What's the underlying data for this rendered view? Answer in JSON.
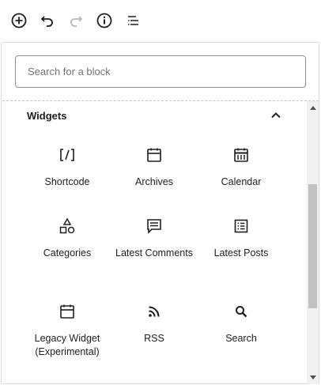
{
  "toolbar": {
    "icons": [
      "add-block-icon",
      "undo-icon",
      "redo-icon",
      "info-icon",
      "list-view-icon"
    ]
  },
  "search": {
    "placeholder": "Search for a block",
    "value": ""
  },
  "panel": {
    "title": "Widgets"
  },
  "blocks": [
    {
      "label": "Shortcode",
      "icon": "shortcode-icon"
    },
    {
      "label": "Archives",
      "icon": "archives-icon"
    },
    {
      "label": "Calendar",
      "icon": "calendar-icon"
    },
    {
      "label": "Categories",
      "icon": "categories-icon"
    },
    {
      "label": "Latest Comments",
      "icon": "latest-comments-icon"
    },
    {
      "label": "Latest Posts",
      "icon": "latest-posts-icon"
    },
    {
      "label": "Legacy Widget (Experimental)",
      "icon": "legacy-widget-icon"
    },
    {
      "label": "RSS",
      "icon": "rss-icon"
    },
    {
      "label": "Search",
      "icon": "search-icon"
    }
  ]
}
